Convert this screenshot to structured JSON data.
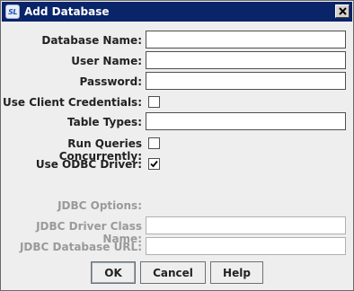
{
  "window": {
    "title": "Add Database",
    "icon_text": "SL",
    "icon": "app-logo-icon",
    "close_icon": "close-icon"
  },
  "form": {
    "database_name": {
      "label": "Database Name:",
      "value": ""
    },
    "user_name": {
      "label": "User Name:",
      "value": ""
    },
    "password": {
      "label": "Password:",
      "value": ""
    },
    "use_client_credentials": {
      "label": "Use Client Credentials:",
      "checked": false
    },
    "table_types": {
      "label": "Table Types:",
      "value": ""
    },
    "run_queries_concurrently": {
      "label": "Run Queries Concurrently:",
      "checked": false
    },
    "use_odbc_driver": {
      "label": "Use ODBC Driver:",
      "checked": true
    }
  },
  "jdbc": {
    "options_label": "JDBC Options:",
    "driver_class_name": {
      "label": "JDBC Driver Class Name:",
      "value": "",
      "enabled": false
    },
    "database_url": {
      "label": "JDBC Database URL:",
      "value": "",
      "enabled": false
    }
  },
  "buttons": {
    "ok": "OK",
    "cancel": "Cancel",
    "help": "Help"
  },
  "colors": {
    "titlebar": "#0a246a",
    "dialog_background": "#eeeeee",
    "disabled_text": "#9a9a9a"
  }
}
